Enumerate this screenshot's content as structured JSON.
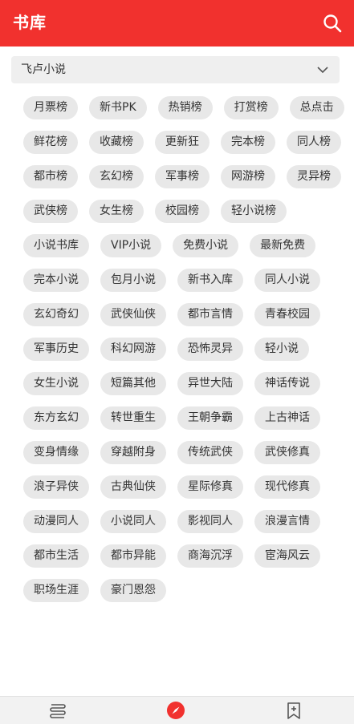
{
  "header": {
    "title": "书库"
  },
  "selector": {
    "value": "飞卢小说"
  },
  "tags": [
    "月票榜",
    "新书PK",
    "热销榜",
    "打赏榜",
    "总点击",
    "鲜花榜",
    "收藏榜",
    "更新狂",
    "完本榜",
    "同人榜",
    "都市榜",
    "玄幻榜",
    "军事榜",
    "网游榜",
    "灵异榜",
    "武侠榜",
    "女生榜",
    "校园榜",
    "轻小说榜",
    "小说书库",
    "VIP小说",
    "免费小说",
    "最新免费",
    "完本小说",
    "包月小说",
    "新书入库",
    "同人小说",
    "玄幻奇幻",
    "武侠仙侠",
    "都市言情",
    "青春校园",
    "军事历史",
    "科幻网游",
    "恐怖灵异",
    "轻小说",
    "女生小说",
    "短篇其他",
    "异世大陆",
    "神话传说",
    "东方玄幻",
    "转世重生",
    "王朝争霸",
    "上古神话",
    "变身情缘",
    "穿越附身",
    "传统武侠",
    "武侠修真",
    "浪子异侠",
    "古典仙侠",
    "星际修真",
    "现代修真",
    "动漫同人",
    "小说同人",
    "影视同人",
    "浪漫言情",
    "都市生活",
    "都市异能",
    "商海沉浮",
    "宦海风云",
    "职场生涯",
    "豪门恩怨"
  ],
  "bottom_nav": {
    "items": [
      {
        "icon": "bookshelf-icon"
      },
      {
        "icon": "compass-icon",
        "active": true
      },
      {
        "icon": "bookmark-icon"
      }
    ]
  },
  "colors": {
    "accent": "#f1312e",
    "tag_bg": "#e8e8e8"
  }
}
